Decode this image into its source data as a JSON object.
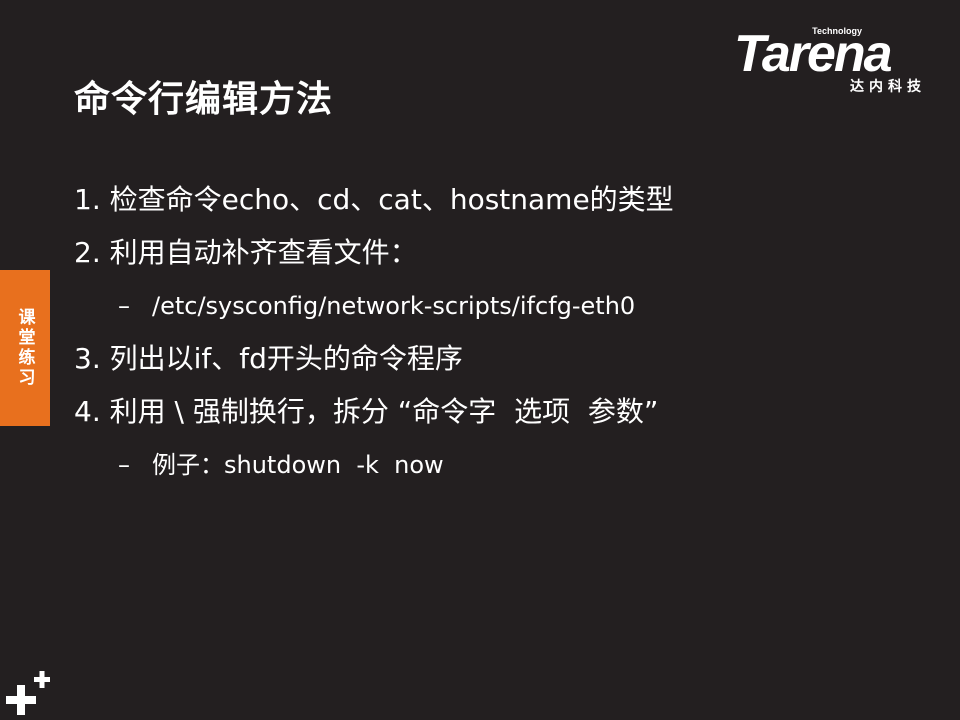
{
  "slide": {
    "title": "命令行编辑方法"
  },
  "logo": {
    "tagline": "Technology",
    "brand": "Tarena",
    "chinese": "达内科技"
  },
  "side_tab": {
    "label": "课堂练习"
  },
  "content": {
    "items": [
      {
        "marker": "1.",
        "text": "检查命令echo、cd、cat、hostname的类型"
      },
      {
        "marker": "2.",
        "text": "利用自动补齐查看文件："
      },
      {
        "marker": "–",
        "text": "/etc/sysconfig/network-scripts/ifcfg-eth0"
      },
      {
        "marker": "3.",
        "text": "列出以if、fd开头的命令程序"
      },
      {
        "marker": "4.",
        "text": "利用 \\ 强制换行，拆分 “命令字  选项  参数”"
      },
      {
        "marker": "–",
        "text": "例子：shutdown  -k  now"
      }
    ]
  },
  "colors": {
    "background": "#231f20",
    "accent": "#e8701e",
    "text": "#ffffff"
  },
  "icons": {
    "corner": "plus-icon"
  }
}
